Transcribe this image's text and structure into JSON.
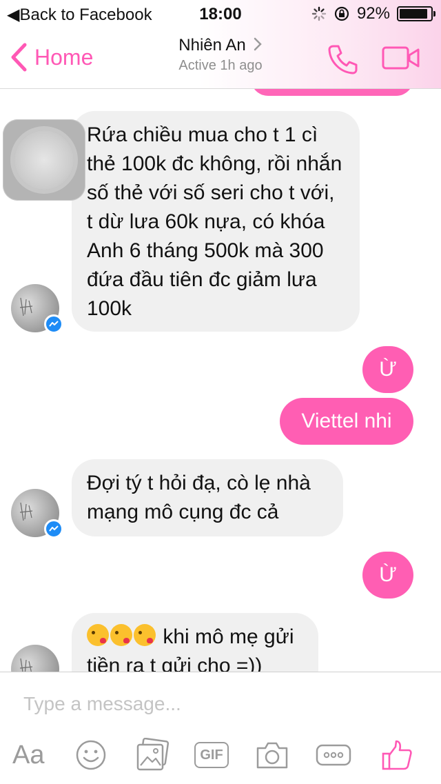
{
  "status_bar": {
    "back_label": "Back to Facebook",
    "time": "18:00",
    "battery_percent": "92%",
    "battery_level": 0.92
  },
  "nav": {
    "back_label": "Home",
    "contact_name": "Nhiên An",
    "presence": "Active 1h ago"
  },
  "messages": [
    {
      "sender": "contact",
      "text": "Rứa chiều mua cho t 1 cì thẻ 100k đc không, rồi nhắn số thẻ với số seri cho t với, t dừ lưa 60k nựa, có khóa Anh 6 tháng 500k mà 300 đứa đầu tiên đc giảm lưa 100k"
    },
    {
      "sender": "me",
      "text": "Ừ"
    },
    {
      "sender": "me",
      "text": "Viettel nhi"
    },
    {
      "sender": "contact",
      "text": "Đợi tý t hỏi đạ, cò lẹ nhà mạng mô cụng đc cả"
    },
    {
      "sender": "me",
      "text": "Ừ"
    },
    {
      "sender": "contact",
      "emoji": [
        "kissing-heart-emoji",
        "kissing-heart-emoji",
        "kissing-heart-emoji"
      ],
      "text": "khi mô mẹ gửi tiền ra t gửi cho =))"
    }
  ],
  "composer": {
    "placeholder": "Type a message...",
    "aa_label": "Aa",
    "gif_label": "GIF"
  },
  "colors": {
    "accent": "#ff58b5",
    "outgoing_bubble": "#ff5eb3",
    "incoming_bubble": "#f0f0f0",
    "messenger_badge": "#1e8cf6"
  }
}
